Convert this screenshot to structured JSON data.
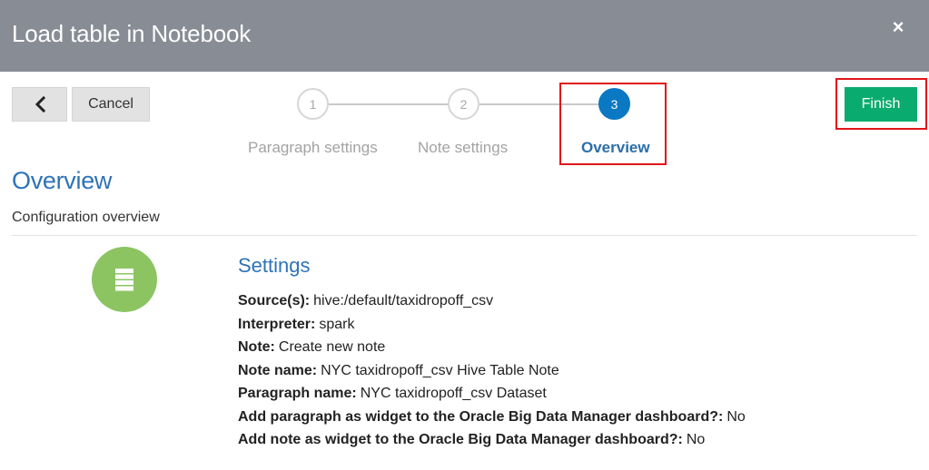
{
  "dialog": {
    "title": "Load table in Notebook",
    "close_label": "×"
  },
  "toolbar": {
    "cancel_label": "Cancel",
    "finish_label": "Finish"
  },
  "steps": [
    {
      "number": "1",
      "label": "Paragraph settings",
      "active": false
    },
    {
      "number": "2",
      "label": "Note settings",
      "active": false
    },
    {
      "number": "3",
      "label": "Overview",
      "active": true
    }
  ],
  "section": {
    "title": "Overview",
    "subtitle": "Configuration overview"
  },
  "settings": {
    "title": "Settings",
    "icon": "list-icon",
    "items": [
      {
        "key": "Source(s):",
        "value": "hive:/default/taxidropoff_csv"
      },
      {
        "key": "Interpreter:",
        "value": "spark"
      },
      {
        "key": "Note:",
        "value": "Create new note"
      },
      {
        "key": "Note name:",
        "value": "NYC taxidropoff_csv Hive Table Note"
      },
      {
        "key": "Paragraph name:",
        "value": "NYC taxidropoff_csv Dataset"
      },
      {
        "key": "Add paragraph as widget to the Oracle Big Data Manager dashboard?:",
        "value": "No"
      },
      {
        "key": "Add note as widget to the Oracle Big Data Manager dashboard?:",
        "value": "No"
      }
    ]
  },
  "colors": {
    "header_bg": "#878c95",
    "accent_blue": "#2e73b8",
    "active_step": "#0a78c3",
    "finish_green": "#0aab6f",
    "settings_icon_green": "#8cc462",
    "highlight_red": "#e0161a"
  }
}
